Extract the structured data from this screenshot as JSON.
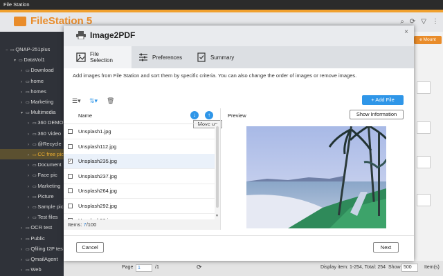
{
  "window": {
    "title": "File Station"
  },
  "app": {
    "logo_text": "FileStation 5",
    "mount_label": "e Mount"
  },
  "sidebar": {
    "items": [
      {
        "label": "QNAP-251plus",
        "arrow": "−"
      },
      {
        "label": "DataVol1",
        "arrow": "▾"
      },
      {
        "label": "Download",
        "arrow": "›"
      },
      {
        "label": "home",
        "arrow": "›"
      },
      {
        "label": "homes",
        "arrow": "›"
      },
      {
        "label": "Marketing",
        "arrow": "›"
      },
      {
        "label": "Multimedia",
        "arrow": "▾"
      },
      {
        "label": "360 DEMO",
        "arrow": "›"
      },
      {
        "label": "360 Video",
        "arrow": "›"
      },
      {
        "label": "@Recycle",
        "arrow": "›"
      },
      {
        "label": "CC free pic",
        "arrow": "›"
      },
      {
        "label": "Document",
        "arrow": "›"
      },
      {
        "label": "Face pic",
        "arrow": "›"
      },
      {
        "label": "Marketing",
        "arrow": "›"
      },
      {
        "label": "Picture",
        "arrow": "›"
      },
      {
        "label": "Sample pic",
        "arrow": "›"
      },
      {
        "label": "Test files",
        "arrow": "›"
      },
      {
        "label": "OCR test",
        "arrow": "›"
      },
      {
        "label": "Public",
        "arrow": "›"
      },
      {
        "label": "Qfiling I2P tes",
        "arrow": "›"
      },
      {
        "label": "QmailAgent",
        "arrow": "›"
      },
      {
        "label": "Web",
        "arrow": "›"
      }
    ]
  },
  "bottombar": {
    "page_label": "Page",
    "page_value": "1",
    "page_total": "/1",
    "display_info": "Display item: 1-254, Total: 254",
    "show_label": "Show",
    "show_value": "500",
    "items_label": "Item(s)"
  },
  "dialog": {
    "title": "Image2PDF",
    "close": "×",
    "steps": [
      "File Selection",
      "Preferences",
      "Summary"
    ],
    "description": "Add images from File Station and sort them by specific criteria. You can also change the order of images or remove images.",
    "add_file_label": "+ Add File",
    "column_name": "Name",
    "tooltip": "Move up",
    "files": [
      {
        "name": "Unsplash1.jpg",
        "checked": false
      },
      {
        "name": "Unsplash112.jpg",
        "checked": false
      },
      {
        "name": "Unsplash235.jpg",
        "checked": true
      },
      {
        "name": "Unsplash237.jpg",
        "checked": false
      },
      {
        "name": "Unsplash264.jpg",
        "checked": false
      },
      {
        "name": "Unsplash292.jpg",
        "checked": false
      },
      {
        "name": "Unsplash96.jpg",
        "checked": false
      }
    ],
    "items_label": "Items:",
    "items_selected": "7",
    "items_total": "/100",
    "preview_label": "Preview",
    "show_info_label": "Show Information",
    "cancel_label": "Cancel",
    "next_label": "Next"
  },
  "colors": {
    "accent": "#2f96e8",
    "brand": "#e98c2a"
  }
}
